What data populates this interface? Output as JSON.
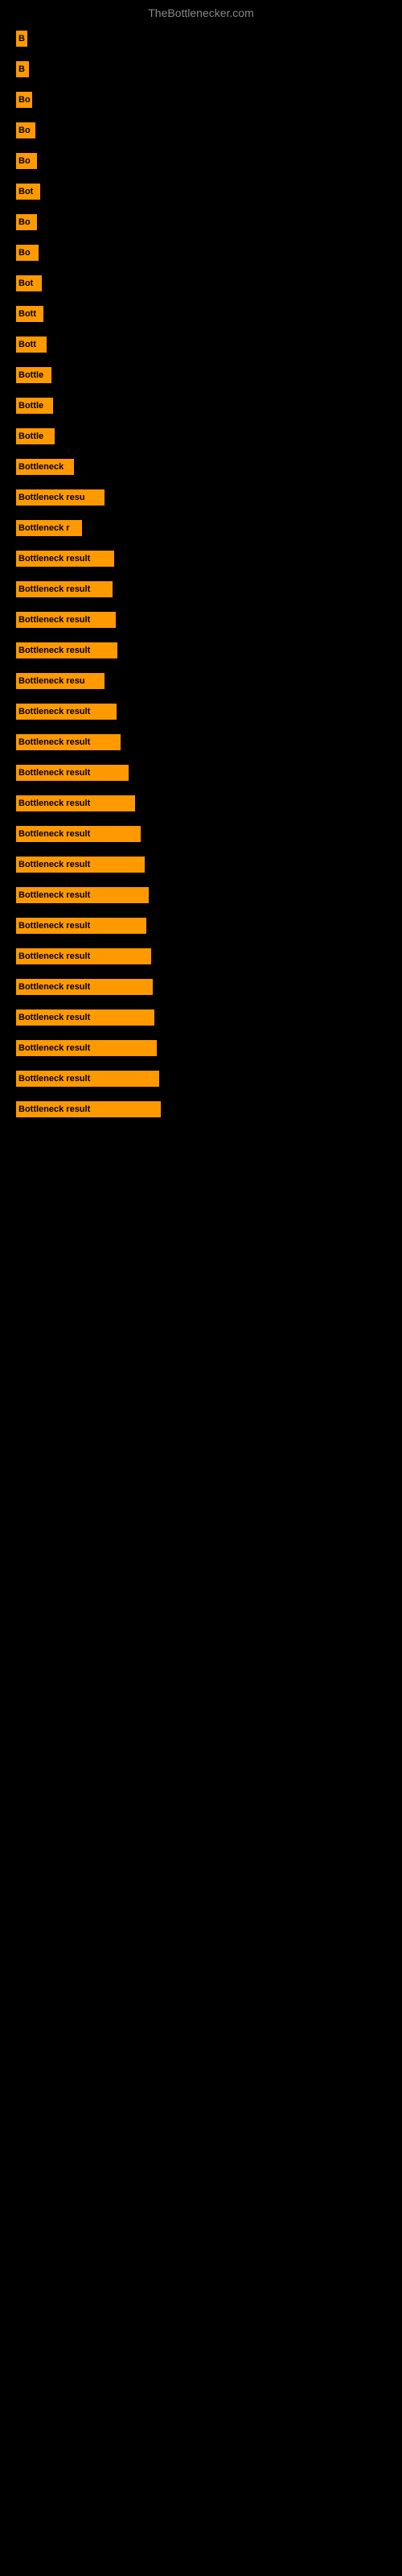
{
  "site": {
    "title": "TheBottlenecker.com"
  },
  "bars": [
    {
      "label": "B",
      "width": 14
    },
    {
      "label": "B",
      "width": 16
    },
    {
      "label": "Bo",
      "width": 20
    },
    {
      "label": "Bo",
      "width": 24
    },
    {
      "label": "Bo",
      "width": 26
    },
    {
      "label": "Bot",
      "width": 30
    },
    {
      "label": "Bo",
      "width": 26
    },
    {
      "label": "Bo",
      "width": 28
    },
    {
      "label": "Bot",
      "width": 32
    },
    {
      "label": "Bott",
      "width": 34
    },
    {
      "label": "Bott",
      "width": 38
    },
    {
      "label": "Bottle",
      "width": 44
    },
    {
      "label": "Bottle",
      "width": 46
    },
    {
      "label": "Bottle",
      "width": 48
    },
    {
      "label": "Bottleneck",
      "width": 72
    },
    {
      "label": "Bottleneck resu",
      "width": 110
    },
    {
      "label": "Bottleneck r",
      "width": 82
    },
    {
      "label": "Bottleneck result",
      "width": 122
    },
    {
      "label": "Bottleneck result",
      "width": 120
    },
    {
      "label": "Bottleneck result",
      "width": 124
    },
    {
      "label": "Bottleneck result",
      "width": 126
    },
    {
      "label": "Bottleneck resu",
      "width": 110
    },
    {
      "label": "Bottleneck result",
      "width": 125
    },
    {
      "label": "Bottleneck result",
      "width": 130
    },
    {
      "label": "Bottleneck result",
      "width": 140
    },
    {
      "label": "Bottleneck result",
      "width": 148
    },
    {
      "label": "Bottleneck result",
      "width": 155
    },
    {
      "label": "Bottleneck result",
      "width": 160
    },
    {
      "label": "Bottleneck result",
      "width": 165
    },
    {
      "label": "Bottleneck result",
      "width": 162
    },
    {
      "label": "Bottleneck result",
      "width": 168
    },
    {
      "label": "Bottleneck result",
      "width": 170
    },
    {
      "label": "Bottleneck result",
      "width": 172
    },
    {
      "label": "Bottleneck result",
      "width": 175
    },
    {
      "label": "Bottleneck result",
      "width": 178
    },
    {
      "label": "Bottleneck result",
      "width": 180
    }
  ]
}
